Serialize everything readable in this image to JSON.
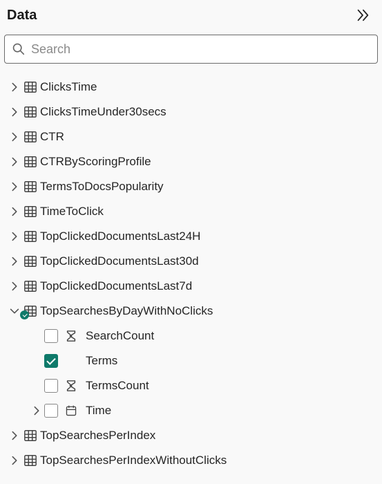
{
  "header": {
    "title": "Data"
  },
  "search": {
    "placeholder": "Search",
    "value": ""
  },
  "tables": [
    {
      "name": "ClicksTime",
      "expanded": false
    },
    {
      "name": "ClicksTimeUnder30secs",
      "expanded": false
    },
    {
      "name": "CTR",
      "expanded": false
    },
    {
      "name": "CTRByScoringProfile",
      "expanded": false
    },
    {
      "name": "TermsToDocsPopularity",
      "expanded": false
    },
    {
      "name": "TimeToClick",
      "expanded": false
    },
    {
      "name": "TopClickedDocumentsLast24H",
      "expanded": false
    },
    {
      "name": "TopClickedDocumentsLast30d",
      "expanded": false
    },
    {
      "name": "TopClickedDocumentsLast7d",
      "expanded": false
    },
    {
      "name": "TopSearchesByDayWithNoClicks",
      "expanded": true,
      "hasSelection": true,
      "fields": [
        {
          "name": "SearchCount",
          "type": "numeric",
          "checked": false,
          "expandable": false
        },
        {
          "name": "Terms",
          "type": "text",
          "checked": true,
          "expandable": false
        },
        {
          "name": "TermsCount",
          "type": "numeric",
          "checked": false,
          "expandable": false
        },
        {
          "name": "Time",
          "type": "date",
          "checked": false,
          "expandable": true
        }
      ]
    },
    {
      "name": "TopSearchesPerIndex",
      "expanded": false
    },
    {
      "name": "TopSearchesPerIndexWithoutClicks",
      "expanded": false
    }
  ]
}
